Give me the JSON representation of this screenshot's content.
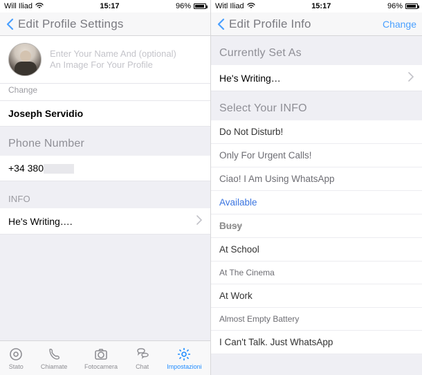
{
  "left": {
    "status": {
      "carrier": "Will Iliad",
      "time": "15:17",
      "battery_pct": "96%"
    },
    "nav": {
      "title": "Edit Profile Settings"
    },
    "profile": {
      "hint_line1": "Enter Your Name And (optional)",
      "hint_line2": "An Image For Your Profile",
      "change_label": "Change",
      "name": "Joseph Servidio"
    },
    "phone_header": "Phone Number",
    "phone_value": "+34 380",
    "info_header": "INFO",
    "info_value": "He's Writing….",
    "tabs": {
      "stato": "Stato",
      "chiamate": "Chiamate",
      "fotocamera": "Fotocamera",
      "chat": "Chat",
      "impostazioni": "Impostazioni"
    }
  },
  "right": {
    "status": {
      "carrier": "Witl Iliad",
      "time": "15:17",
      "battery_pct": "96%"
    },
    "nav": {
      "title": "Edit Profile Info",
      "action": "Change"
    },
    "currently_header": "Currently Set As",
    "currently_value": "He's Writing…",
    "select_header": "Select Your INFO",
    "options": [
      "Do Not Disturb!",
      "Only For Urgent Calls!",
      "Ciao! I Am Using WhatsApp",
      "Available",
      "Busy",
      "At School",
      "At The Cinema",
      "At Work",
      "Almost Empty Battery",
      "I Can't Talk. Just WhatsApp"
    ]
  }
}
